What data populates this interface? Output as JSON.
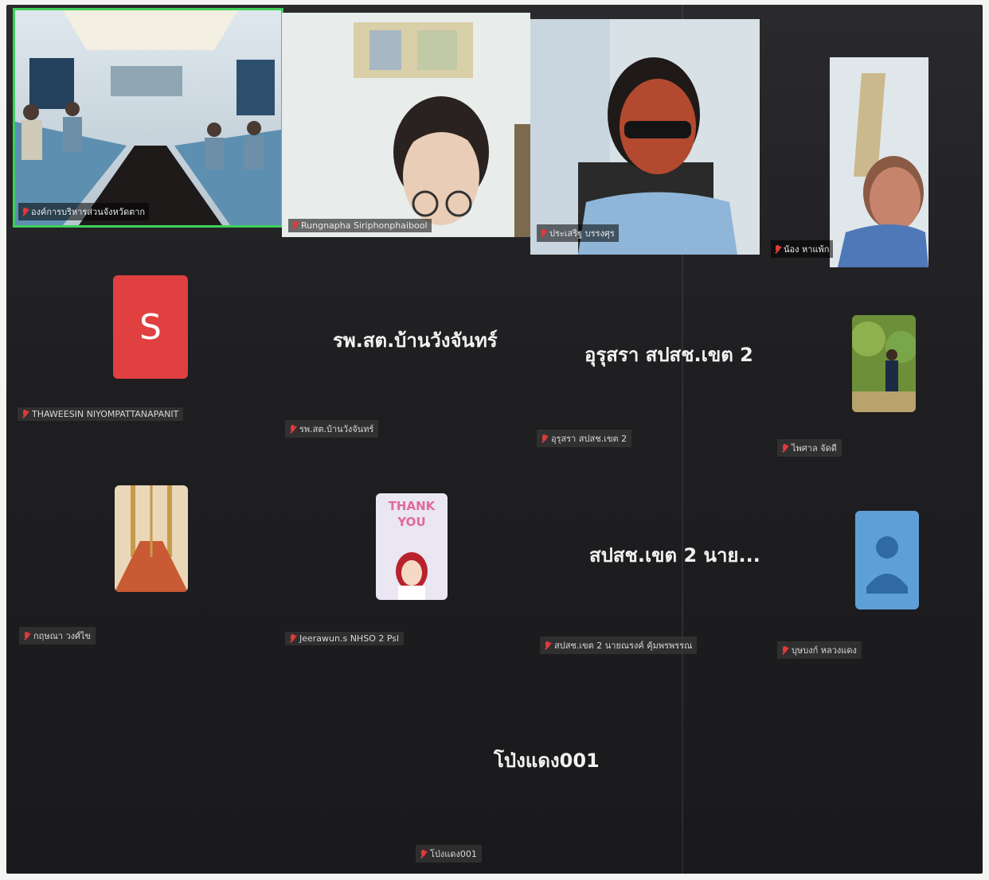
{
  "top_row": [
    {
      "name": "องค์การบริหารส่วนจังหวัดตาก",
      "active_speaker": true
    },
    {
      "name": "Rungnapha Siriphonphaibool"
    },
    {
      "name": "ประเสริฐ บรรงศุร"
    },
    {
      "name": "น้อง หาแพ้ก"
    }
  ],
  "grid": [
    {
      "display": "S",
      "type": "letter",
      "label": "THAWEESIN NIYOMPATTANAPANIT",
      "color": "#e04040"
    },
    {
      "display": "รพ.สต.บ้านวังจันทร์",
      "type": "text",
      "label": "รพ.สต.บ้านวังจันทร์"
    },
    {
      "display": "อุรุสรา สปสช.เขต 2",
      "type": "text",
      "label": "อุรุสรา สปสช.เขต 2"
    },
    {
      "display": "",
      "type": "photo",
      "label": "ไพศาล จัดดี"
    },
    {
      "display": "",
      "type": "photo",
      "label": "กฤษณา วงศ์ไข"
    },
    {
      "display": "THANK YOU",
      "type": "sticker",
      "label": "Jeerawun.s NHSO 2 Psl"
    },
    {
      "display": "สปสช.เขต 2 นาย...",
      "type": "text",
      "label": "สปสช.เขต 2 นายณรงค์ คุ้มพรพรรณ"
    },
    {
      "display": "",
      "type": "default-avatar",
      "label": "บุษบงก์ หลวงแดง"
    },
    {
      "display": "โป่งแดง001",
      "type": "text",
      "label": "โป่งแดง001"
    }
  ],
  "icons": {
    "muted": "mic-off-icon",
    "default_avatar": "person-icon"
  },
  "colors": {
    "background": "#1c1c1e",
    "active_border": "#3fd05a",
    "muted_icon": "#e03a3a"
  }
}
